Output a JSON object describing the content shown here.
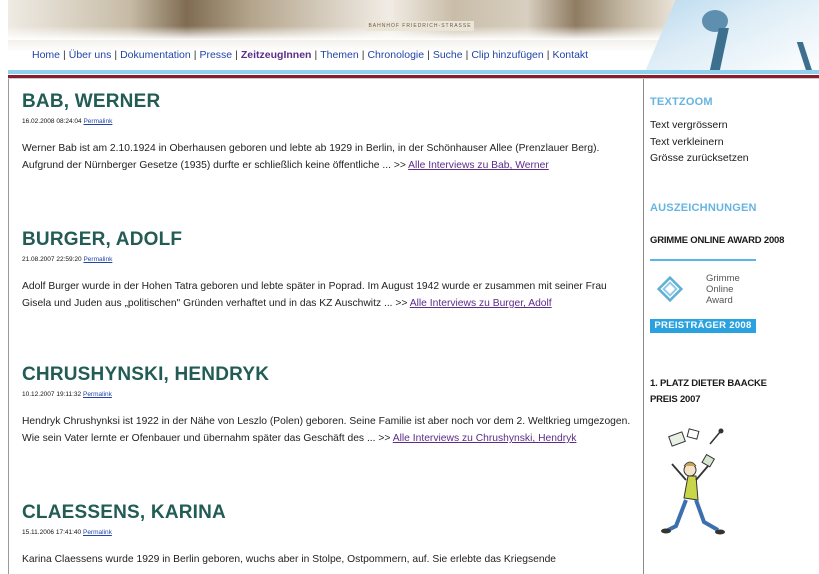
{
  "banner": {
    "sign_text": "BAHNHOF FRIEDRICH-STRASSE"
  },
  "nav": {
    "items": [
      {
        "label": "Home"
      },
      {
        "label": "Über uns"
      },
      {
        "label": "Dokumentation"
      },
      {
        "label": "Presse"
      },
      {
        "label": "ZeitzeugInnen",
        "active": true
      },
      {
        "label": "Themen"
      },
      {
        "label": "Chronologie"
      },
      {
        "label": "Suche"
      },
      {
        "label": "Clip hinzufügen"
      },
      {
        "label": "Kontakt"
      }
    ],
    "separator": "|"
  },
  "entries": [
    {
      "title": "BAB, WERNER",
      "date": "16.02.2008 08:24:04",
      "permalink": "Permalink",
      "text": "Werner Bab ist am 2.10.1924 in Oberhausen geboren und lebte ab 1929 in Berlin, in der Schönhauser Allee (Prenzlauer Berg). Aufgrund der Nürnberger Gesetze (1935) durfte er schließlich keine öffentliche ... >> ",
      "more": "Alle Interviews zu Bab, Werner"
    },
    {
      "title": "BURGER, ADOLF",
      "date": "21.08.2007 22:59:20",
      "permalink": "Permalink",
      "text": "Adolf Burger wurde in der Hohen Tatra geboren und lebte später in Poprad. Im August 1942 wurde er zusammen mit seiner Frau Gisela und Juden aus „politischen\" Gründen verhaftet und in das KZ Auschwitz ... >> ",
      "more": "Alle Interviews zu Burger, Adolf"
    },
    {
      "title": "CHRUSHYNSKI, HENDRYK",
      "date": "10.12.2007 19:11:32",
      "permalink": "Permalink",
      "text": "Hendryk Chrushynksi ist 1922 in der Nähe von Leszlo (Polen) geboren. Seine Familie ist aber noch vor dem 2. Weltkrieg umgezogen. Wie sein Vater lernte er Ofenbauer und übernahm später das Geschäft des ... >> ",
      "more": "Alle Interviews zu Chrushynski, Hendryk"
    },
    {
      "title": "CLAESSENS, KARINA",
      "date": "15.11.2006 17:41:40",
      "permalink": "Permalink",
      "text": "Karina Claessens wurde 1929 in Berlin geboren, wuchs aber in Stolpe, Ostpommern, auf. Sie erlebte das Kriegsende",
      "more": ""
    }
  ],
  "sidebar": {
    "textzoom": {
      "heading": "TEXTZOOM",
      "links": [
        "Text vergrössern",
        "Text verkleinern",
        "Grösse zurücksetzen"
      ]
    },
    "awards": {
      "heading": "AUSZEICHNUNGEN",
      "grimme_title": "GRIMME ONLINE AWARD 2008",
      "grimme_logo_lines": [
        "Grimme",
        "Online",
        "Award"
      ],
      "grimme_band": "PREISTRÄGER 2008",
      "baacke_title": "1. PLATZ DIETER BAACKE PREIS 2007"
    }
  },
  "colors": {
    "title_teal": "#225c55",
    "sidebar_heading_blue": "#66b4e0",
    "link_blue": "#2244a8",
    "visited_purple": "#5c2c88",
    "rule_red": "#8a1c2e"
  }
}
